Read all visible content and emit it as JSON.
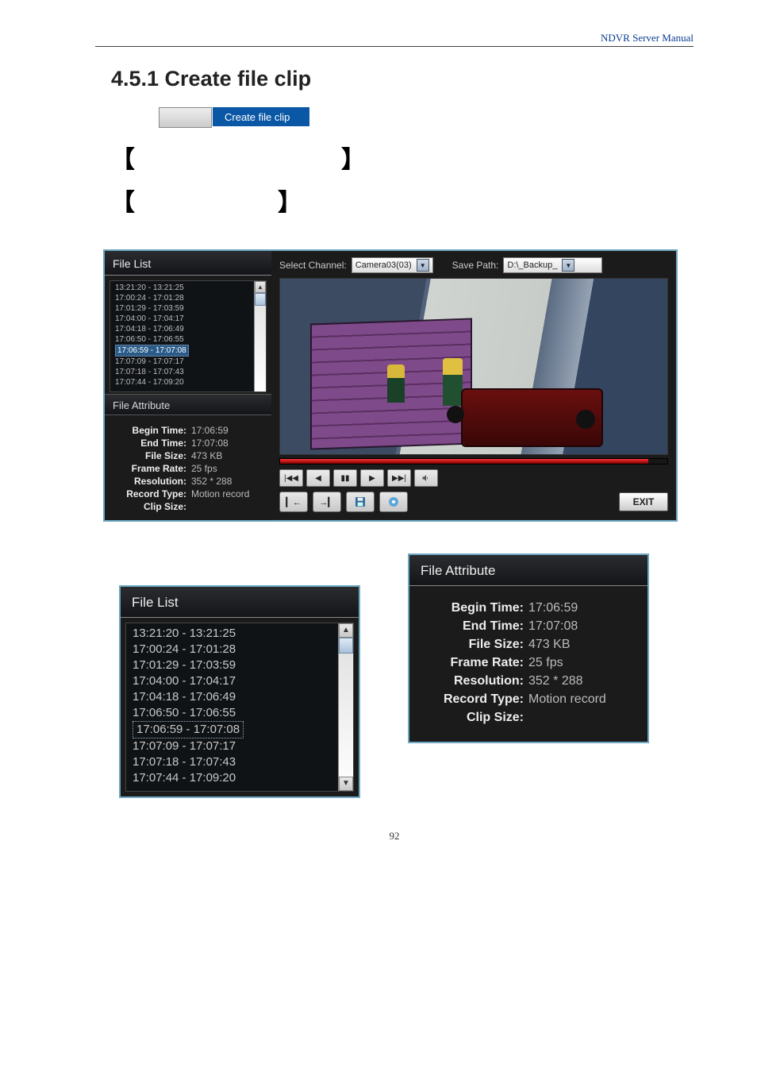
{
  "header": {
    "brand_text": "NDVR Server Manual"
  },
  "section": {
    "heading": "4.5.1 Create file clip",
    "tab_label": "Create file clip"
  },
  "brackets": {
    "open": "【",
    "close": "】"
  },
  "app": {
    "file_list_title": "File List",
    "file_attr_title": "File Attribute",
    "select_channel_label": "Select Channel:",
    "select_channel_value": "Camera03(03)",
    "save_path_label": "Save Path:",
    "save_path_value": "D:\\_Backup_",
    "file_list": [
      "13:21:20 - 13:21:25",
      "17:00:24 - 17:01:28",
      "17:01:29 - 17:03:59",
      "17:04:00 - 17:04:17",
      "17:04:18 - 17:06:49",
      "17:06:50 - 17:06:55",
      "17:06:59 - 17:07:08",
      "17:07:09 - 17:07:17",
      "17:07:18 - 17:07:43",
      "17:07:44 - 17:09:20"
    ],
    "selected_index": 6,
    "attrs": {
      "begin_time_k": "Begin Time:",
      "begin_time_v": "17:06:59",
      "end_time_k": "End Time:",
      "end_time_v": "17:07:08",
      "file_size_k": "File Size:",
      "file_size_v": "473 KB",
      "frame_rate_k": "Frame Rate:",
      "frame_rate_v": "25 fps",
      "resolution_k": "Resolution:",
      "resolution_v": "352 * 288",
      "record_type_k": "Record Type:",
      "record_type_v": "Motion record",
      "clip_size_k": "Clip Size:",
      "clip_size_v": ""
    },
    "exit_label": "EXIT"
  },
  "page_number": "92"
}
